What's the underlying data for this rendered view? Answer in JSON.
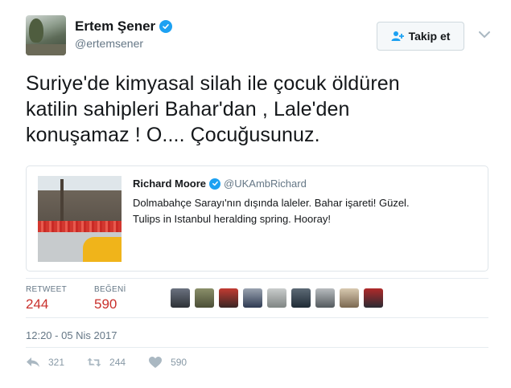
{
  "author": {
    "display_name": "Ertem Şener",
    "handle": "@ertemsener",
    "avatar_icon": "profile-photo"
  },
  "follow_button": {
    "label": "Takip et",
    "icon": "add-user-icon"
  },
  "tweet": {
    "lines": [
      "Suriye'de kimyasal silah ile çocuk öldüren",
      "katilin sahipleri Bahar'dan , Lale'den",
      "konuşamaz ! O.... Çocuğusunuz."
    ]
  },
  "quote": {
    "name": "Richard Moore",
    "handle": "@UKAmbRichard",
    "lines": [
      "Dolmabahçe Sarayı'nın dışında laleler.   Bahar işareti!  Güzel.",
      "Tulips in Istanbul heralding spring.  Hooray!"
    ],
    "image_icon": "tulips-photo"
  },
  "stats": {
    "retweet_label": "RETWEET",
    "retweet_value": "244",
    "likes_label": "BEĞENİ",
    "likes_value": "590",
    "liker_count": 9
  },
  "timestamp": "12:20 - 05 Nis 2017",
  "actions": {
    "reply_count": "321",
    "retweet_count": "244",
    "like_count": "590"
  },
  "colors": {
    "verified": "#1da1f2",
    "stat_value": "#c9302c",
    "muted": "#657786"
  }
}
